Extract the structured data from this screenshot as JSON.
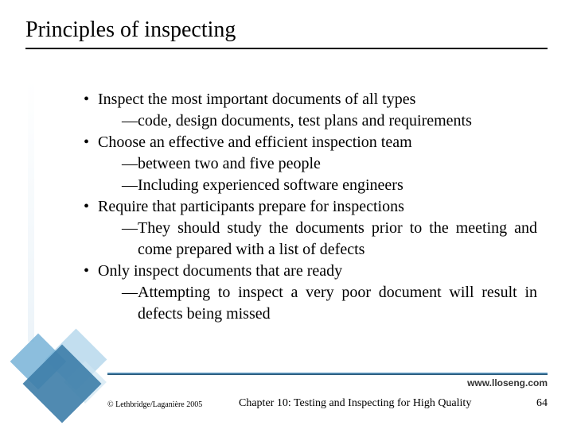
{
  "title": "Principles of inspecting",
  "bullets": [
    {
      "text": "Inspect the most important documents of all types",
      "subs": [
        {
          "text": "code, design documents, test plans and requirements",
          "justify": false
        }
      ]
    },
    {
      "text": "Choose an effective and efficient inspection team",
      "subs": [
        {
          "text": "between two and five people",
          "justify": false
        },
        {
          "text": "Including experienced software engineers",
          "justify": false
        }
      ]
    },
    {
      "text": "Require that participants prepare for inspections",
      "subs": [
        {
          "text": "They should study the documents prior to the meeting and come prepared with a list of defects",
          "justify": true
        }
      ]
    },
    {
      "text": "Only inspect documents that are ready",
      "subs": [
        {
          "text": "Attempting to inspect a very poor document will result in defects being missed",
          "justify": true
        }
      ]
    }
  ],
  "footer": {
    "url": "www.lloseng.com",
    "copyright": "© Lethbridge/Laganière 2005",
    "chapter": "Chapter 10: Testing and Inspecting for High Quality",
    "page": "64"
  }
}
